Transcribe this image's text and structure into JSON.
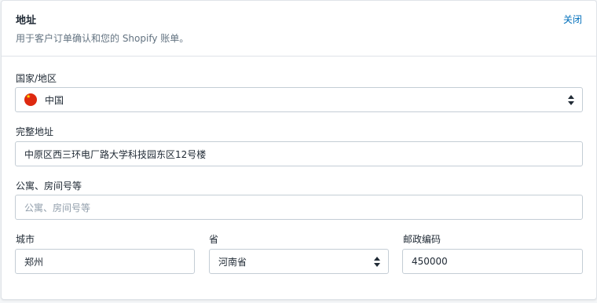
{
  "header": {
    "title": "地址",
    "subtitle": "用于客户订单确认和您的 Shopify 账单。",
    "close_label": "关闭"
  },
  "form": {
    "country": {
      "label": "国家/地区",
      "value": "中国"
    },
    "address": {
      "label": "完整地址",
      "value": "中原区西三环电厂路大学科技园东区12号楼"
    },
    "apartment": {
      "label": "公寓、房间号等",
      "placeholder": "公寓、房间号等"
    },
    "city": {
      "label": "城市",
      "value": "郑州"
    },
    "province": {
      "label": "省",
      "value": "河南省"
    },
    "postal": {
      "label": "邮政编码",
      "value": "450000"
    }
  },
  "colors": {
    "link": "#006fbb",
    "border": "#c4cdd5",
    "flag_red": "#de2910"
  }
}
